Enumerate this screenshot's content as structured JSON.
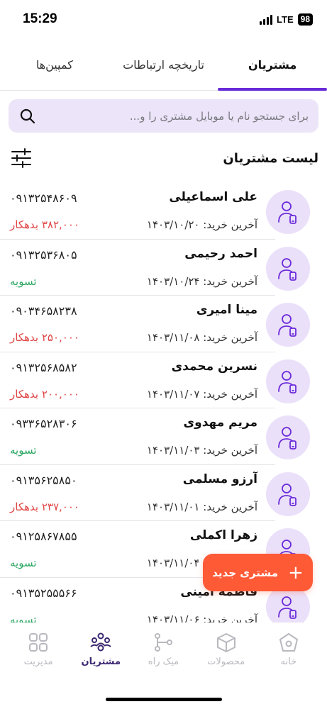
{
  "status": {
    "time": "15:29",
    "network": "LTE",
    "battery": "98"
  },
  "tabs": [
    {
      "label": "مشتریان",
      "active": true
    },
    {
      "label": "تاریخچه ارتباطات",
      "active": false
    },
    {
      "label": "کمپین‌ها",
      "active": false
    }
  ],
  "search": {
    "placeholder": "برای جستجو نام یا موبایل مشتری را و..."
  },
  "list_title": "لیست مشتریان",
  "last_purchase_label": "آخرین خرید:",
  "customers": [
    {
      "name": "علی اسماعیلی",
      "phone": "۰۹۱۳۲۵۴۸۶۰۹",
      "last_purchase": "۱۴۰۳/۱۰/۲۰",
      "balance": "۳۸۲,۰۰۰ بدهکار",
      "status": "debt"
    },
    {
      "name": "احمد رحیمی",
      "phone": "۰۹۱۳۲۵۳۶۸۰۵",
      "last_purchase": "۱۴۰۳/۱۰/۲۴",
      "balance": "تسویه",
      "status": "settled"
    },
    {
      "name": "مینا امیری",
      "phone": "۰۹۰۳۴۶۵۸۲۳۸",
      "last_purchase": "۱۴۰۳/۱۱/۰۸",
      "balance": "۲۵۰,۰۰۰ بدهکار",
      "status": "debt"
    },
    {
      "name": "نسرین محمدی",
      "phone": "۰۹۱۳۲۵۶۸۵۸۲",
      "last_purchase": "۱۴۰۳/۱۱/۰۷",
      "balance": "۲۰۰,۰۰۰ بدهکار",
      "status": "debt"
    },
    {
      "name": "مریم مهدوی",
      "phone": "۰۹۳۳۶۵۲۸۳۰۶",
      "last_purchase": "۱۴۰۳/۱۱/۰۳",
      "balance": "تسویه",
      "status": "settled"
    },
    {
      "name": "آرزو مسلمی",
      "phone": "۰۹۱۳۵۶۲۵۸۵۰",
      "last_purchase": "۱۴۰۳/۱۱/۰۱",
      "balance": "۲۳۷,۰۰۰ بدهکار",
      "status": "debt"
    },
    {
      "name": "زهرا اکملی",
      "phone": "۰۹۱۲۵۸۶۷۸۵۵",
      "last_purchase": "۱۴۰۳/۱۱/۰۴",
      "balance": "تسویه",
      "status": "settled"
    },
    {
      "name": "فاطمه امینی",
      "phone": "۰۹۱۳۵۲۵۵۵۶۶",
      "last_purchase": "۱۴۰۳/۱۱/۰۶",
      "balance": "تسویه",
      "status": "settled"
    }
  ],
  "fab": {
    "label": "مشتری جدید",
    "plus": "+"
  },
  "bottom_nav": [
    {
      "label": "خانه",
      "icon": "home-icon",
      "active": false
    },
    {
      "label": "محصولات",
      "icon": "box-icon",
      "active": false
    },
    {
      "label": "میک راه",
      "icon": "flow-icon",
      "active": false
    },
    {
      "label": "مشتریان",
      "icon": "customers-icon",
      "active": true
    },
    {
      "label": "مدیریت",
      "icon": "grid-icon",
      "active": false
    }
  ],
  "colors": {
    "accent": "#6a2cd8",
    "fab": "#ff5a36",
    "debt": "#e04545",
    "settled": "#2fa865",
    "avatar_bg": "#ebe0fa",
    "search_bg": "#ece4f8"
  }
}
